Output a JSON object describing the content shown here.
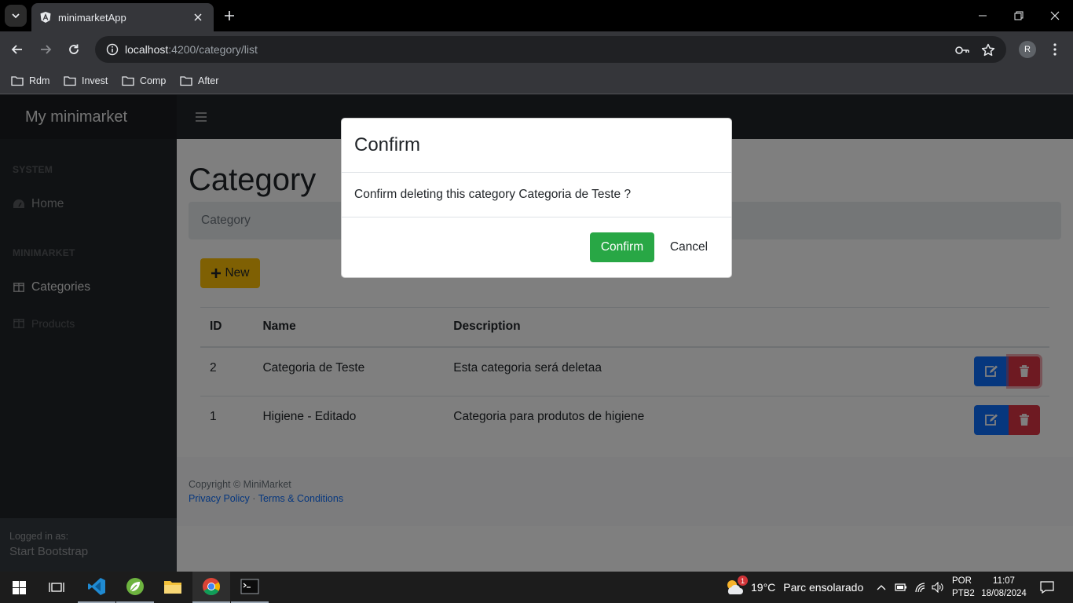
{
  "browser": {
    "tab_title": "minimarketApp",
    "url_host": "localhost",
    "url_path": ":4200/category/list",
    "bookmarks": [
      "Rdm",
      "Invest",
      "Comp",
      "After"
    ],
    "profile_initial": "R"
  },
  "app": {
    "brand": "My minimarket",
    "sidebar": {
      "section_system": "SYSTEM",
      "home": "Home",
      "section_minimarket": "MINIMARKET",
      "categories": "Categories",
      "products": "Products",
      "footer_label": "Logged in as:",
      "footer_name": "Start Bootstrap"
    },
    "page_title": "Category",
    "breadcrumb": "Category",
    "new_button": "New",
    "table": {
      "headers": [
        "ID",
        "Name",
        "Description"
      ],
      "rows": [
        {
          "id": "2",
          "name": "Categoria de Teste",
          "description": "Esta categoria será deletaa"
        },
        {
          "id": "1",
          "name": "Higiene - Editado",
          "description": "Categoria para produtos de higiene"
        }
      ]
    },
    "footer": {
      "copyright": "Copyright © MiniMarket",
      "privacy": "Privacy Policy",
      "separator": "·",
      "terms": "Terms & Conditions"
    }
  },
  "modal": {
    "title": "Confirm",
    "message": "Confirm deleting this category Categoria de Teste ?",
    "confirm_label": "Confirm",
    "cancel_label": "Cancel"
  },
  "taskbar": {
    "weather_badge": "1",
    "temperature": "19°C",
    "weather_text": "Parc ensolarado",
    "lang_line1": "POR",
    "lang_line2": "PTB2",
    "time": "11:07",
    "date": "18/08/2024"
  },
  "colors": {
    "confirm": "#28a745",
    "new": "#ffc107",
    "edit": "#0d6efd",
    "delete": "#dc3545",
    "sidebar": "#212529"
  }
}
